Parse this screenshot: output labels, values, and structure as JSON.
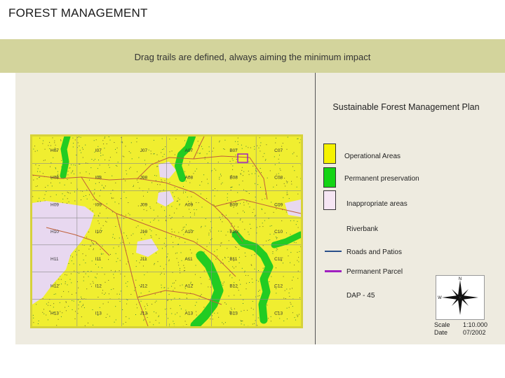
{
  "header": {
    "title": "FOREST MANAGEMENT",
    "subtitle": "Drag trails are defined, always aiming the minimum impact"
  },
  "legend": {
    "title": "Sustainable Forest Management Plan",
    "items": [
      {
        "label": "Operational Areas",
        "color": "#f5f200"
      },
      {
        "label": "Permanent preservation",
        "color": "#14d414"
      },
      {
        "label": "Inappropriate areas",
        "color": "#f6e6f4"
      },
      {
        "label": "Riverbank"
      },
      {
        "label": "Roads and Patios",
        "color": "#2a4f8a"
      },
      {
        "label": "Permanent Parcel",
        "color": "#a020c0"
      }
    ],
    "dap": "DAP - 45"
  },
  "map": {
    "colors": {
      "operational": "#f0ee30",
      "preservation": "#22cc22",
      "inappropriate": "#e8d8f0",
      "roads": "#c0603a",
      "grid": "#8a8a8a",
      "border": "#d6d23a"
    },
    "cells": [
      [
        "H07",
        "I07",
        "J07",
        "A07",
        "B07",
        "C07"
      ],
      [
        "H08",
        "I08",
        "J08",
        "A08",
        "B08",
        "C08"
      ],
      [
        "H09",
        "I09",
        "J09",
        "A09",
        "B09",
        "C09"
      ],
      [
        "H10",
        "I10",
        "J10",
        "A10",
        "B10",
        "C10"
      ],
      [
        "H11",
        "I11",
        "J11",
        "A11",
        "B11",
        "C11"
      ],
      [
        "H12",
        "I12",
        "J12",
        "A12",
        "B12",
        "C12"
      ],
      [
        "H13",
        "I13",
        "J13",
        "A13",
        "B13",
        "C13"
      ]
    ]
  },
  "compass": {
    "icon": "compass-rose-icon",
    "n": "N",
    "w": "W"
  },
  "scale": {
    "label": "Scale",
    "value": "1:10.000"
  },
  "date": {
    "label": "Date",
    "value": "07/2002"
  }
}
